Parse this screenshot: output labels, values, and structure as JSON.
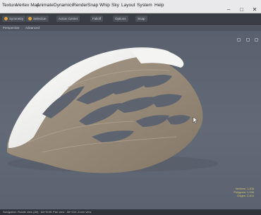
{
  "menubar": {
    "items": [
      "Texture",
      "Vertex Map",
      "Animate",
      "Dynamics",
      "Render",
      "Snap",
      "Whip",
      "Sky",
      "Layout",
      "System",
      "Help"
    ],
    "window_controls": [
      "–",
      "□",
      "✕"
    ]
  },
  "toolbar": {
    "buttons": [
      "Symmetry",
      "Selection",
      "Action Center",
      "Falloff",
      "Options",
      "Snap"
    ]
  },
  "viewport": {
    "view_label": "Perspective",
    "shading_label": "Advanced"
  },
  "stats": {
    "lines": [
      "Vertices: 1,208",
      "Polygons: 1,196",
      "Edges: 2,404"
    ]
  },
  "statusbar": {
    "text": "Navigation: Rotate view (Alt) · Alt+Shift: Pan view · Alt+Ctrl: Zoom view"
  },
  "colors": {
    "viewport_bg": "#5d6472",
    "helmet_shell_white": "#f3f3f1",
    "helmet_wood": "#9a8d7c",
    "vent_holes": "#5d6470"
  }
}
